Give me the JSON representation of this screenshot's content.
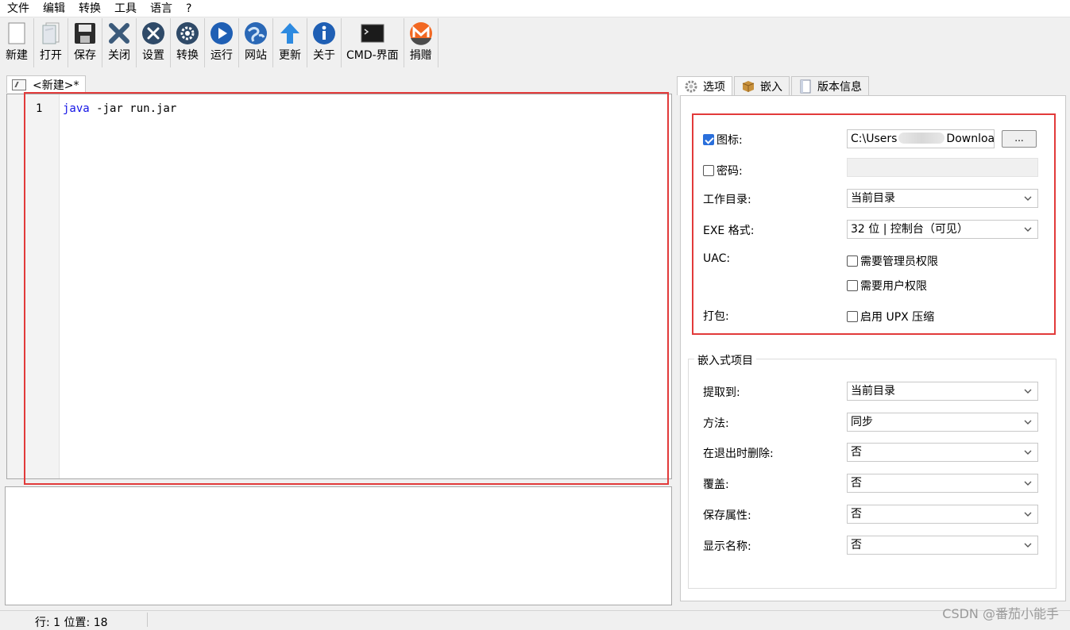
{
  "menu": [
    "文件",
    "编辑",
    "转换",
    "工具",
    "语言",
    "?"
  ],
  "toolbar": [
    {
      "label": "新建",
      "icon": "new-document-icon"
    },
    {
      "label": "打开",
      "icon": "open-file-icon"
    },
    {
      "label": "保存",
      "icon": "save-disk-icon"
    },
    {
      "label": "关闭",
      "icon": "close-x-icon"
    },
    {
      "label": "设置",
      "icon": "settings-wrench-icon"
    },
    {
      "label": "转换",
      "icon": "convert-gear-icon"
    },
    {
      "label": "运行",
      "icon": "run-play-icon"
    },
    {
      "label": "网站",
      "icon": "website-globe-icon"
    },
    {
      "label": "更新",
      "icon": "update-arrow-icon"
    },
    {
      "label": "关于",
      "icon": "about-info-icon"
    },
    {
      "label": "CMD-界面",
      "icon": "cmd-console-icon"
    },
    {
      "label": "捐赠",
      "icon": "donate-monero-icon"
    }
  ],
  "editor": {
    "tab_title": "<新建>*",
    "line_number": "1",
    "code_keyword": "java",
    "code_rest": " -jar run.jar"
  },
  "status": {
    "text": "行: 1  位置: 18"
  },
  "right_tabs": [
    {
      "label": "选项",
      "icon": "gear-icon"
    },
    {
      "label": "嵌入",
      "icon": "package-box-icon"
    },
    {
      "label": "版本信息",
      "icon": "document-icon"
    }
  ],
  "options": {
    "icon_label": "图标:",
    "icon_checked": true,
    "icon_path_start": "C:\\Users",
    "icon_path_end": "Downloa",
    "browse_label": "...",
    "password_label": "密码:",
    "password_checked": false,
    "workdir_label": "工作目录:",
    "workdir_value": "当前目录",
    "exe_label": "EXE 格式:",
    "exe_value": "32 位 | 控制台（可见）",
    "uac_label": "UAC:",
    "uac_admin": "需要管理员权限",
    "uac_user": "需要用户权限",
    "pack_label": "打包:",
    "pack_upx": "启用 UPX 压缩"
  },
  "embedded": {
    "title": "嵌入式项目",
    "rows": [
      {
        "label": "提取到:",
        "value": "当前目录"
      },
      {
        "label": "方法:",
        "value": "同步"
      },
      {
        "label": "在退出时删除:",
        "value": "否"
      },
      {
        "label": "覆盖:",
        "value": "否"
      },
      {
        "label": "保存属性:",
        "value": "否"
      },
      {
        "label": "显示名称:",
        "value": "否"
      }
    ]
  },
  "watermark": "CSDN @番茄小能手",
  "colors": {
    "highlight_box": "#e23a3a",
    "keyword": "#1414e6",
    "checkbox_checked": "#2a6fdb"
  }
}
